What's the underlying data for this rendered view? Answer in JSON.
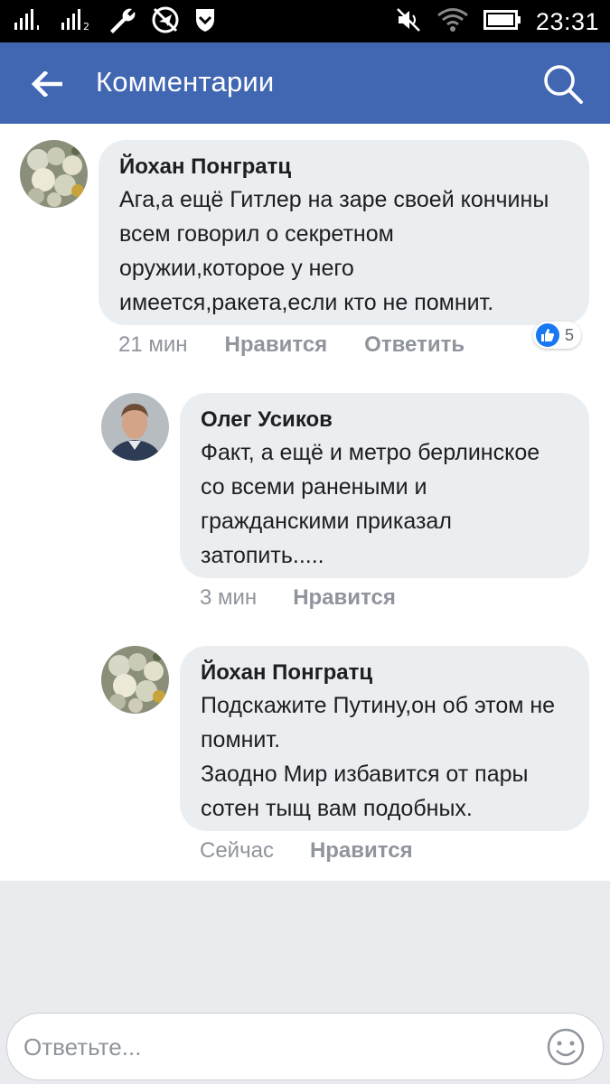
{
  "status_bar": {
    "time": "23:31",
    "icons": [
      "signal-1-icon",
      "signal-2-icon",
      "wrench-icon",
      "no-location-icon",
      "shield-icon",
      "mute-icon",
      "wifi-icon",
      "battery-icon"
    ]
  },
  "app_bar": {
    "title": "Комментарии",
    "back_icon": "arrow-left-icon",
    "search_icon": "search-icon",
    "color": "#4267b2"
  },
  "comments": [
    {
      "author": "Йохан Понгратц",
      "text": "Ага,а ещё Гитлер на заре своей кончины\nвсем говорил о секретном\nоружии,которое у него\nимеется,ракета,если кто не помнит.",
      "time": "21 мин",
      "like_label": "Нравится",
      "reply_label": "Ответить",
      "reaction_count": "5",
      "reaction_icon": "like-thumb-icon"
    },
    {
      "author": "Олег Усиков",
      "text": "Факт, а ещё и метро берлинское\nсо всеми ранеными и\nгражданскими приказал\nзатопить.....",
      "time": "3 мин",
      "like_label": "Нравится"
    },
    {
      "author": "Йохан Понгратц",
      "text": "Подскажите Путину,он об этом не\nпомнит.\nЗаодно Мир избавится от пары\nсотен тыщ вам подобных.",
      "time": "Сейчас",
      "like_label": "Нравится"
    }
  ],
  "reply": {
    "placeholder": "Ответьте...",
    "emoji_icon": "smiley-icon"
  }
}
